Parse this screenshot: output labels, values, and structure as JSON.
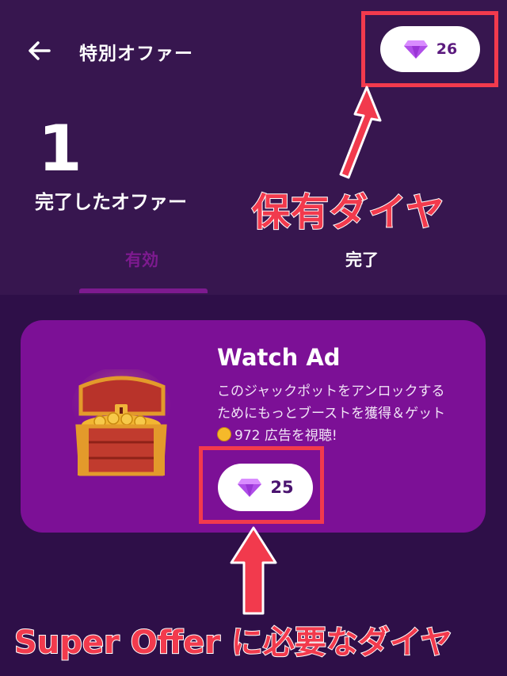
{
  "header": {
    "title": "特別オファー",
    "gem_balance": "26"
  },
  "summary": {
    "completed_count": "1",
    "completed_label": "完了したオファー"
  },
  "tabs": [
    {
      "label": "有効",
      "active": true
    },
    {
      "label": "完了",
      "active": false
    }
  ],
  "offer": {
    "title": "Watch Ad",
    "description_line1": "このジャックポットをアンロックする",
    "description_line2": "ためにもっとブーストを獲得＆ゲット",
    "coin_amount": "972",
    "description_line3": "広告を視聴!",
    "gem_cost": "25"
  },
  "annotations": {
    "top_label": "保有ダイヤ",
    "bottom_label": "Super Offer に必要なダイヤ"
  },
  "colors": {
    "header_bg": "#37164f",
    "page_bg": "#2e0f48",
    "card_bg": "#7c1096",
    "accent": "#7d1a8f",
    "highlight_red": "#f23a4d"
  },
  "icons": [
    "back-arrow-icon",
    "diamond-icon",
    "treasure-chest-icon",
    "coin-icon",
    "arrow-up-icon"
  ]
}
